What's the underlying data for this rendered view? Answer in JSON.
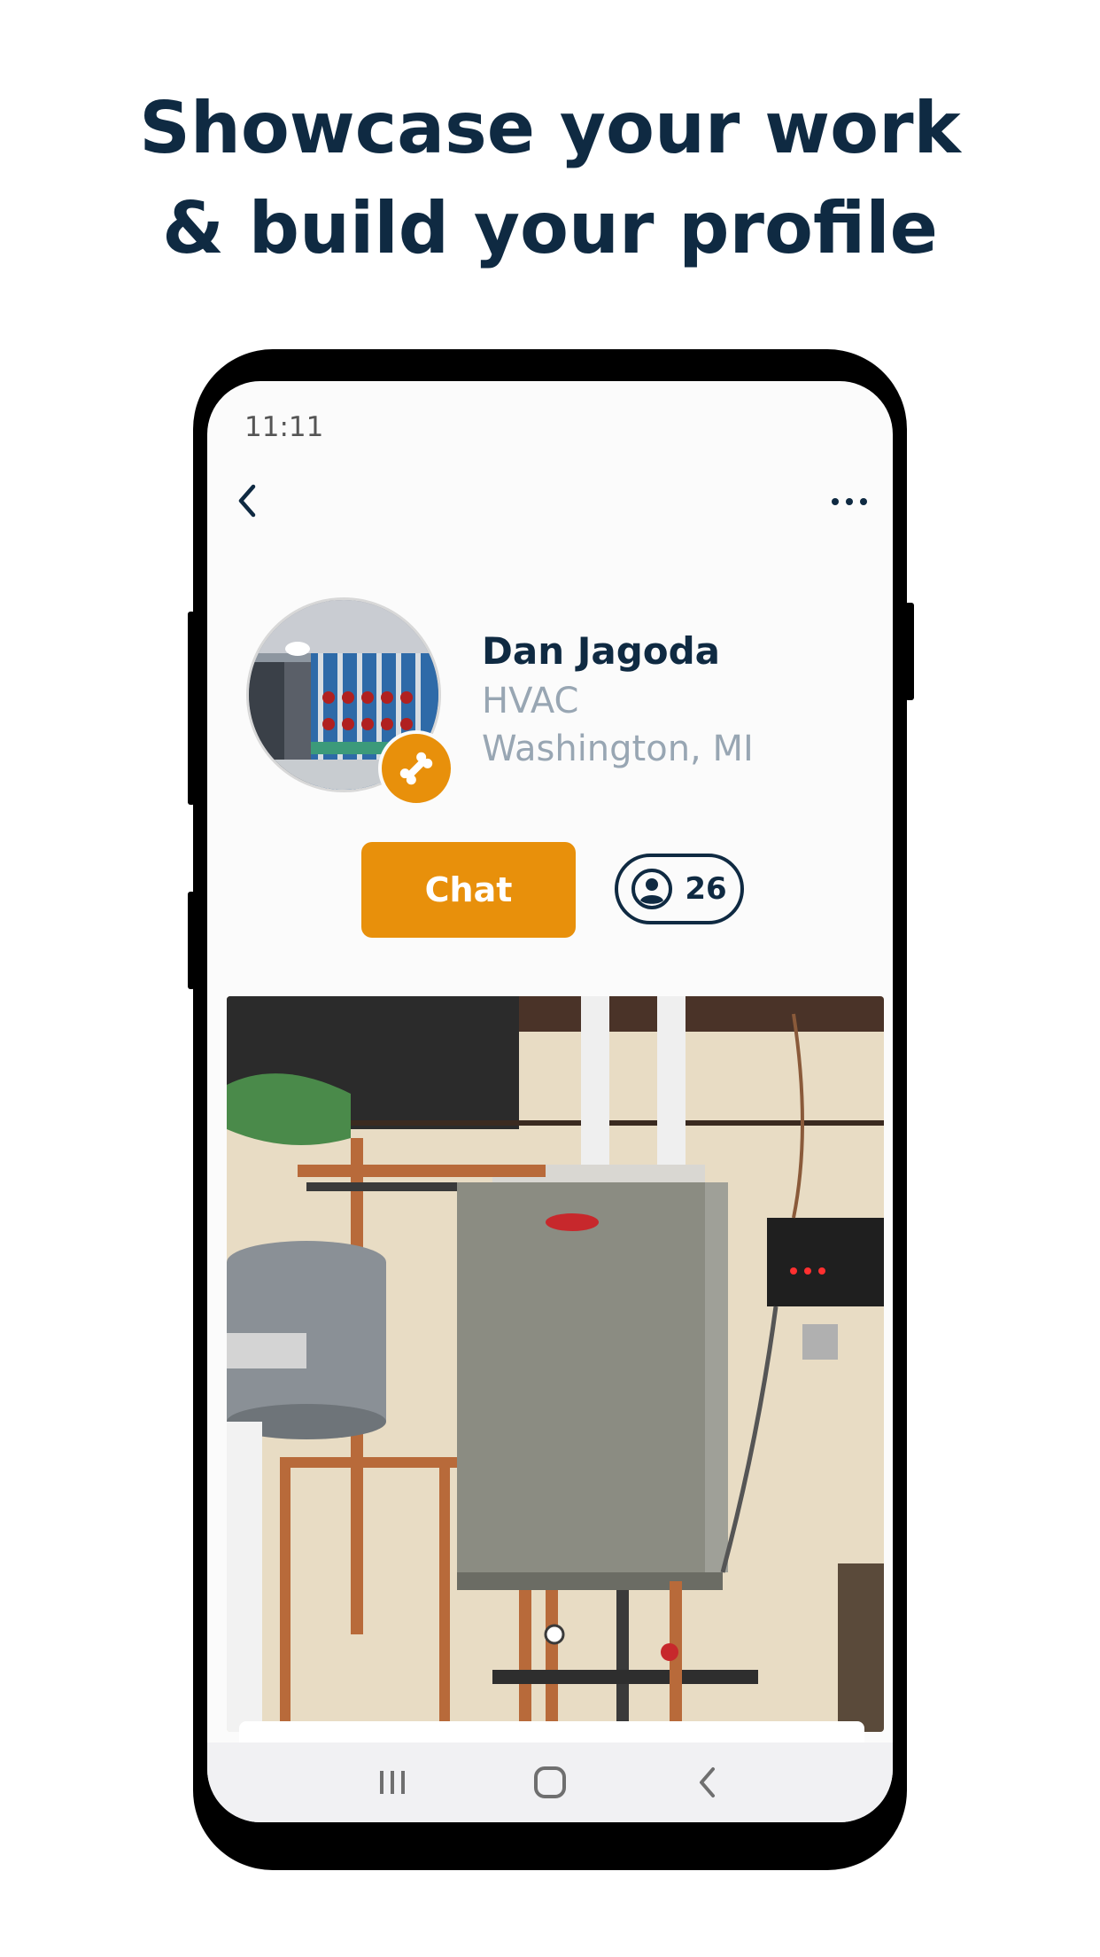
{
  "headline": {
    "line1": "Showcase your work",
    "line2": "& build your profile"
  },
  "status_bar": {
    "time": "11:11"
  },
  "header": {
    "back_icon": "chevron-left-icon",
    "more_icon": "more-horizontal-icon"
  },
  "profile": {
    "name": "Dan Jagoda",
    "trade": "HVAC",
    "location": "Washington, MI",
    "badge_icon": "bone-icon"
  },
  "actions": {
    "chat_label": "Chat",
    "followers_icon": "user-circle-icon",
    "followers_count": "26"
  },
  "nav_bar": {
    "items": [
      "recent-apps-icon",
      "home-icon",
      "back-icon"
    ]
  },
  "colors": {
    "navy": "#0f2a42",
    "accent_orange": "#e8900b",
    "muted_text": "#98a6b3"
  }
}
